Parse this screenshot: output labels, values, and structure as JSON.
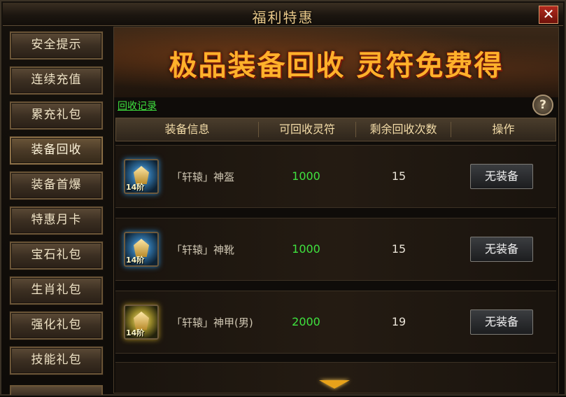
{
  "window": {
    "title": "福利特惠",
    "close_glyph": "✕"
  },
  "sidebar": {
    "items": [
      {
        "label": "安全提示"
      },
      {
        "label": "连续充值"
      },
      {
        "label": "累充礼包"
      },
      {
        "label": "装备回收",
        "active": true
      },
      {
        "label": "装备首爆"
      },
      {
        "label": "特惠月卡"
      },
      {
        "label": "宝石礼包"
      },
      {
        "label": "生肖礼包"
      },
      {
        "label": "强化礼包"
      },
      {
        "label": "技能礼包"
      }
    ]
  },
  "main": {
    "banner_slogan": "极品装备回收 灵符免费得",
    "record_link": "回收记录",
    "help_glyph": "?",
    "table": {
      "headers": [
        "装备信息",
        "可回收灵符",
        "剩余回收次数",
        "操作"
      ],
      "rows": [
        {
          "icon": "helmet-icon",
          "tier": "14阶",
          "name": "「轩辕」神盔",
          "value": "1000",
          "remaining": "15",
          "action": "无装备"
        },
        {
          "icon": "boots-icon",
          "tier": "14阶",
          "name": "「轩辕」神靴",
          "value": "1000",
          "remaining": "15",
          "action": "无装备"
        },
        {
          "icon": "armor-icon",
          "tier": "14阶",
          "name": "「轩辕」神甲(男)",
          "value": "2000",
          "remaining": "19",
          "action": "无装备"
        }
      ]
    }
  },
  "colors": {
    "accent_gold": "#ffb12b",
    "value_green": "#3fe23f",
    "scroll_arrow": "#e8a21a"
  }
}
